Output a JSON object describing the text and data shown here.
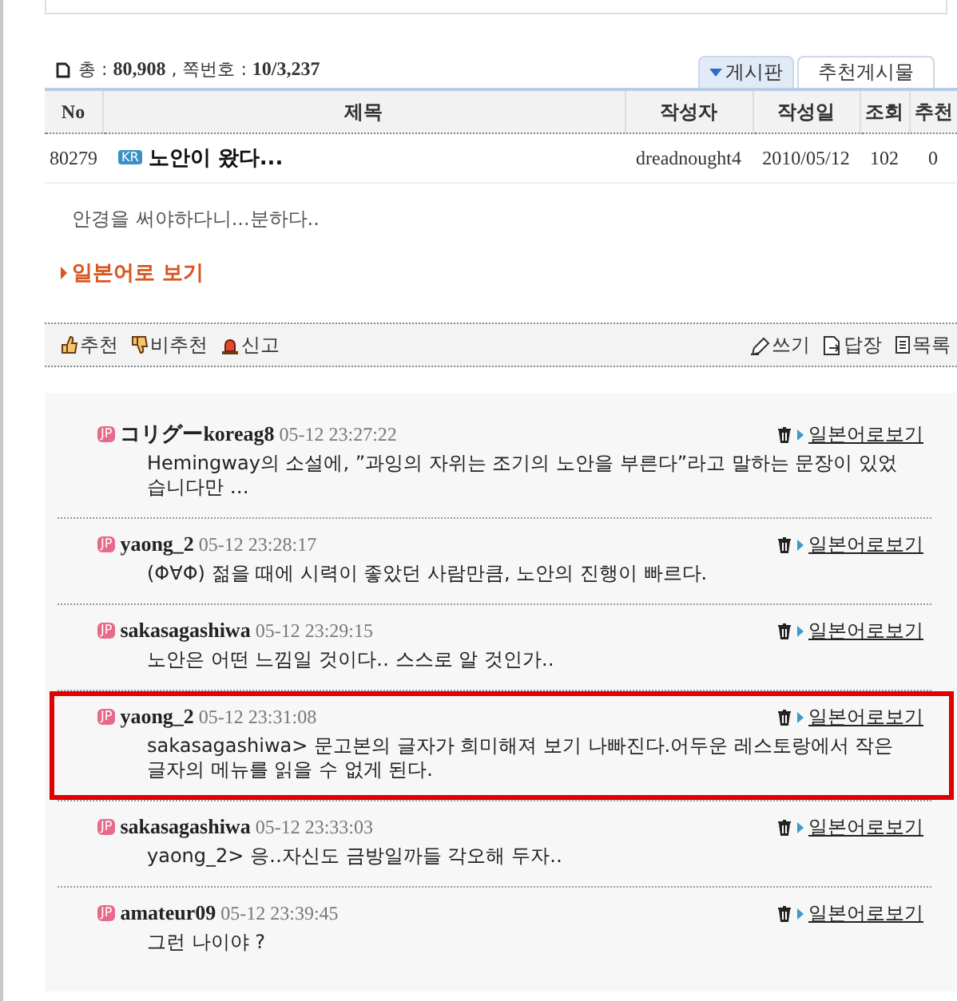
{
  "summary": {
    "text": "총 : **80,908** , 쪽번호 : **10/3,237**"
  },
  "tabs": [
    {
      "label": "게시판",
      "selected": true
    },
    {
      "label": "추천게시물",
      "selected": false
    }
  ],
  "table": {
    "columns": [
      "No",
      "제목",
      "작성자",
      "작성일",
      "조회",
      "추천"
    ],
    "rows": [
      {
        "no": "80279",
        "badge": "KR",
        "title": "노안이 왔다...",
        "author": "dreadnought4",
        "date": "2010/05/12",
        "views": "102",
        "recommends": "0"
      }
    ]
  },
  "post": {
    "body": "안경을 써야하다니...분하다..",
    "translate_link": "일본어로 보기"
  },
  "actions": {
    "left": [
      {
        "kind": "recommend",
        "label": "추천"
      },
      {
        "kind": "not-recommend",
        "label": "비추천"
      },
      {
        "kind": "report",
        "label": "신고"
      }
    ],
    "right": [
      {
        "kind": "write",
        "label": "쓰기"
      },
      {
        "kind": "reply",
        "label": "답장"
      },
      {
        "kind": "list",
        "label": "목록"
      }
    ]
  },
  "comments": [
    {
      "badge": "JP",
      "author": "コリグーkoreag8",
      "time": "05-12 23:27:22",
      "link": "일본어로보기",
      "body": "Hemingway의 소설에,  ”과잉의 자위는 조기의 노안을 부른다”라고 말하는 문장이 있었습니다만 …",
      "highlighted": false
    },
    {
      "badge": "JP",
      "author": "yaong_2",
      "time": "05-12 23:28:17",
      "link": "일본어로보기",
      "body": "(Φ∀Φ) 젊을 때에 시력이 좋았던 사람만큼, 노안의 진행이 빠르다.",
      "highlighted": false
    },
    {
      "badge": "JP",
      "author": "sakasagashiwa",
      "time": "05-12 23:29:15",
      "link": "일본어로보기",
      "body": "노안은 어떤 느낌일 것이다‥  스스로 알 것인가‥",
      "highlighted": false
    },
    {
      "badge": "JP",
      "author": "yaong_2",
      "time": "05-12 23:31:08",
      "link": "일본어로보기",
      "body": "sakasagashiwa> 문고본의 글자가 희미해져 보기 나빠진다.어두운 레스토랑에서 작은 글자의 메뉴를 읽을 수 없게 된다.",
      "highlighted": true
    },
    {
      "badge": "JP",
      "author": "sakasagashiwa",
      "time": "05-12 23:33:03",
      "link": "일본어로보기",
      "body": "yaong_2> 응‥자신도 금방일까들 각오해 두자‥",
      "highlighted": false
    },
    {
      "badge": "JP",
      "author": "amateur09",
      "time": "05-12 23:39:45",
      "link": "일본어로보기",
      "body": "그런 나이야 ?",
      "highlighted": false
    }
  ]
}
